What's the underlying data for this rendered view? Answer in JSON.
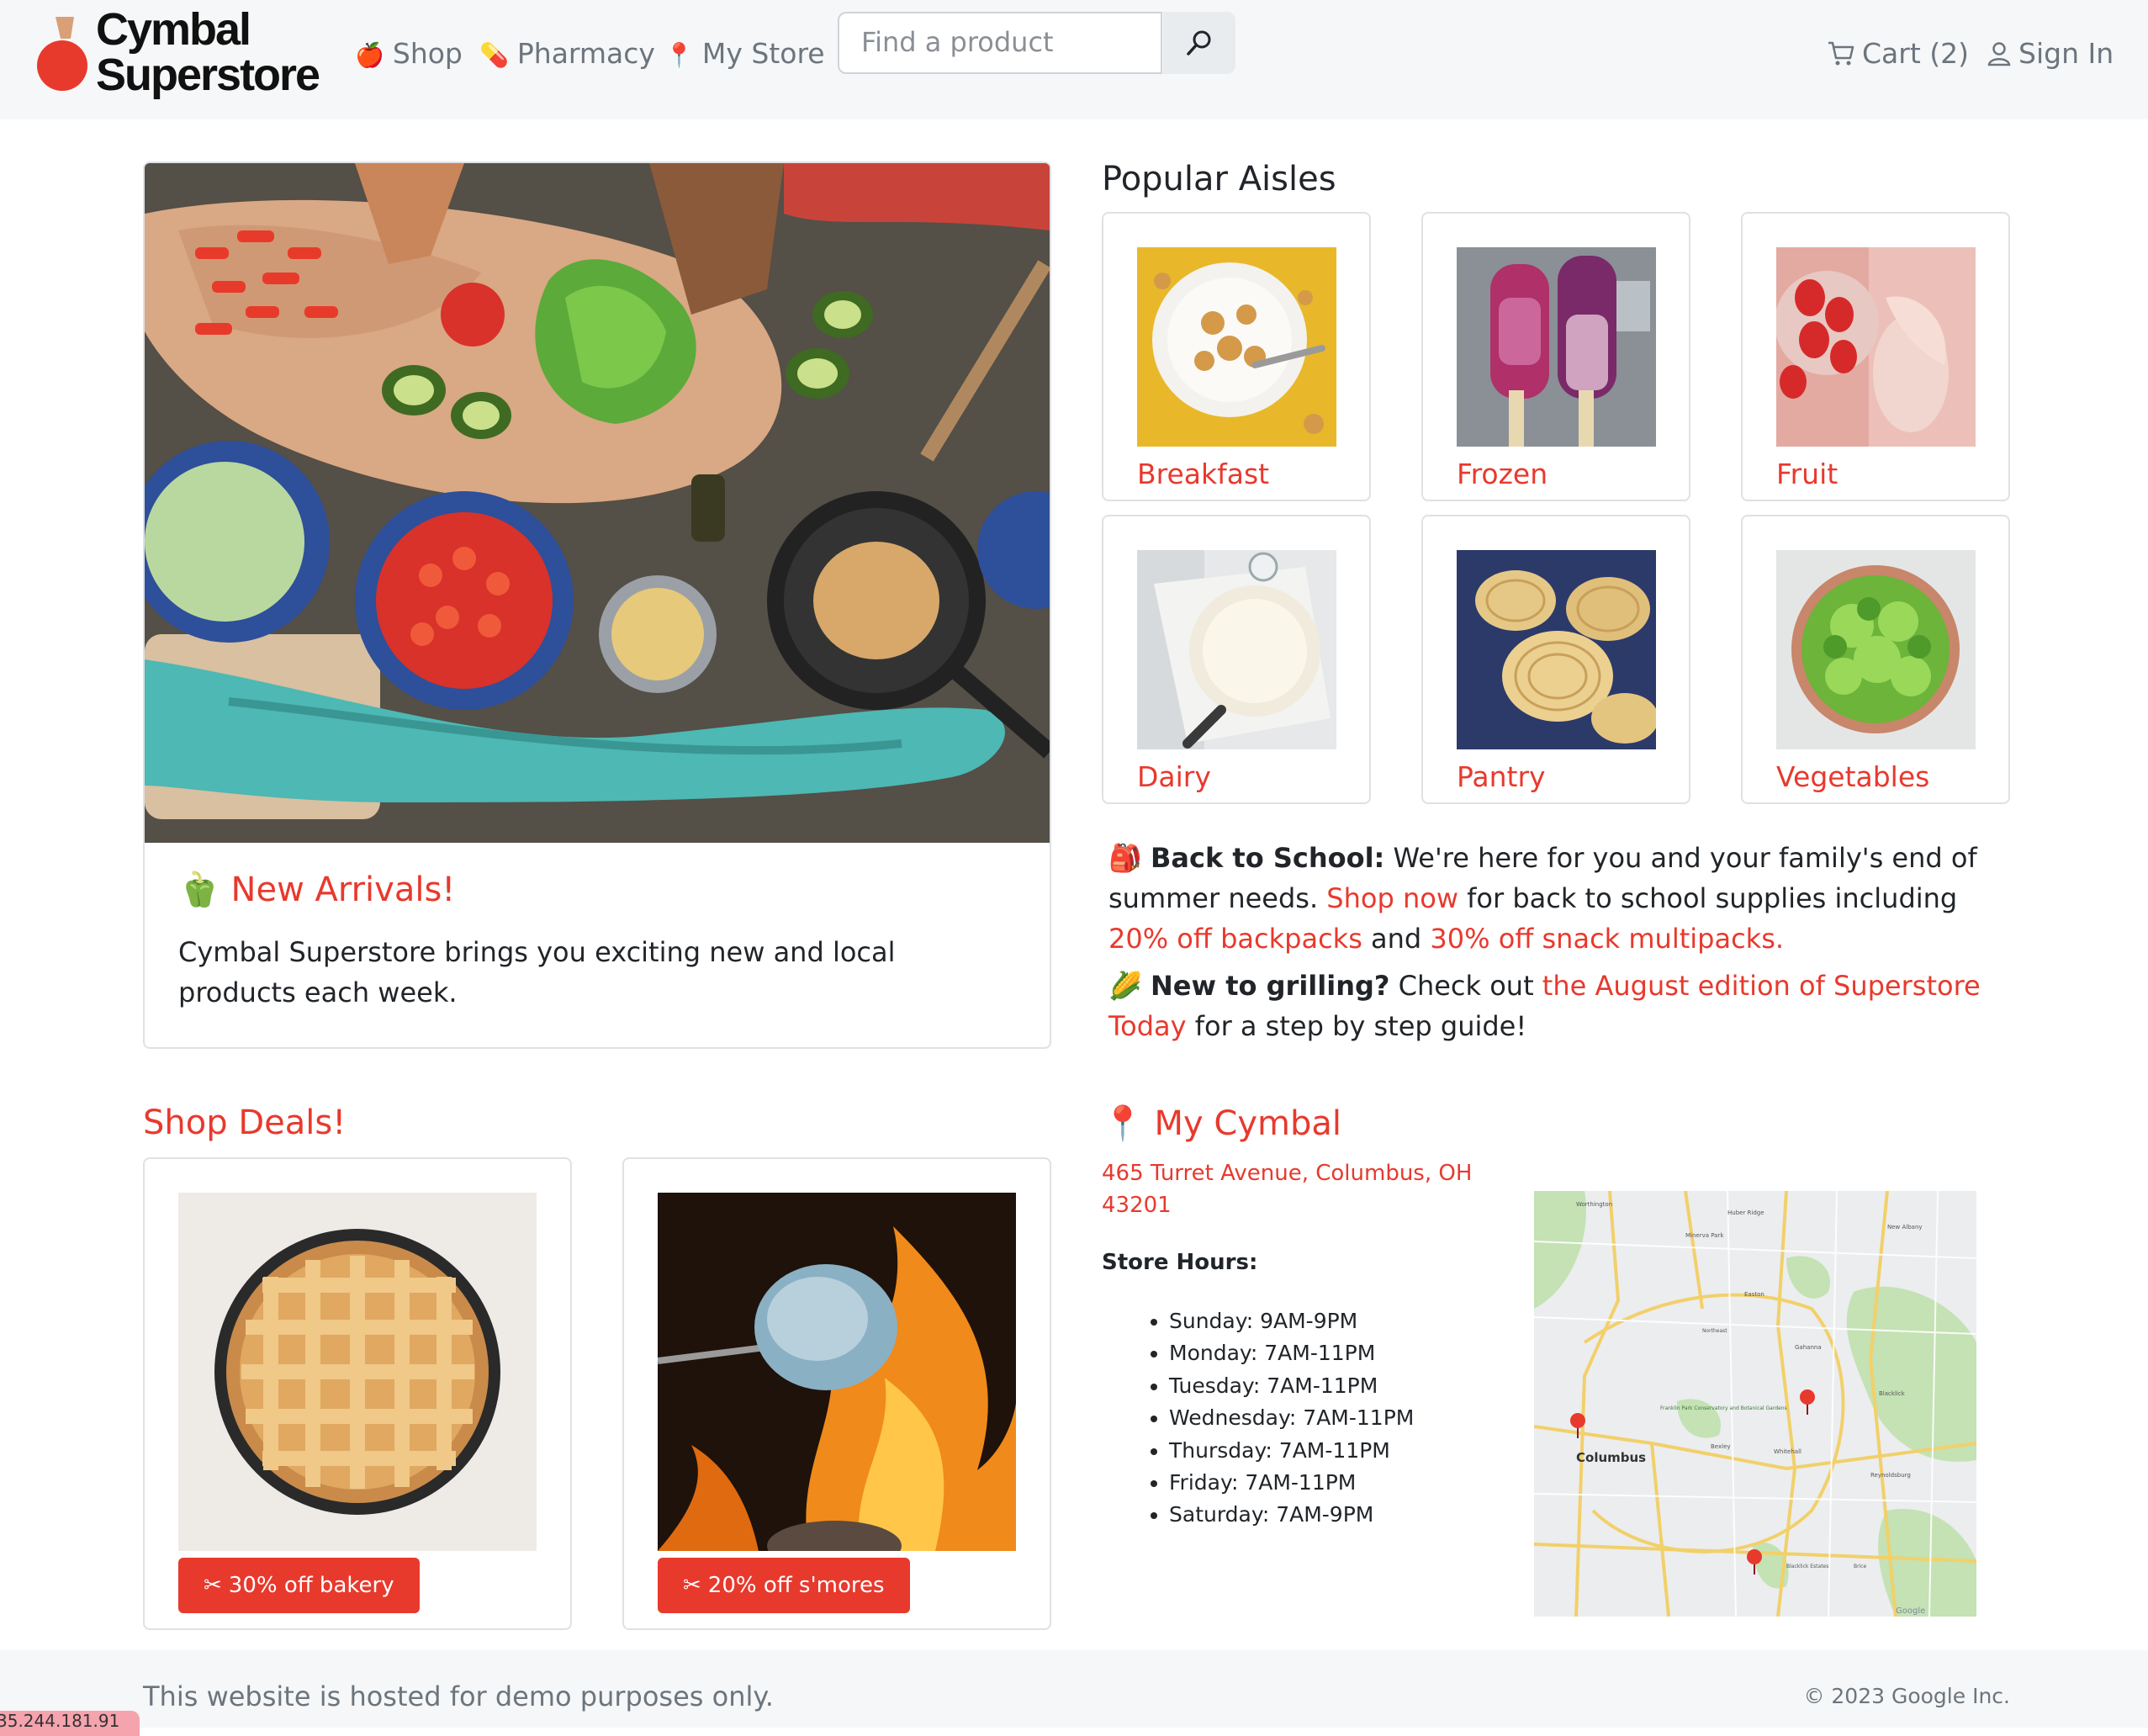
{
  "brand": {
    "line1": "Cymbal",
    "line2": "Superstore",
    "colors": {
      "accent": "#e8392d",
      "logo_leaf": "#d9a078"
    }
  },
  "nav": {
    "shop": {
      "label": "Shop",
      "icon": "apple-emoji"
    },
    "pharmacy": {
      "label": "Pharmacy",
      "icon": "pill-emoji"
    },
    "store": {
      "label": "My Store",
      "icon": "pin-emoji"
    },
    "search": {
      "placeholder": "Find a product",
      "icon": "search-icon"
    },
    "cart": {
      "label": "Cart (2)",
      "icon": "cart-icon"
    },
    "signin": {
      "label": "Sign In",
      "icon": "person-icon"
    }
  },
  "hero": {
    "title": "New Arrivals!",
    "title_icon": "bell-pepper-emoji",
    "text": "Cymbal Superstore brings you exciting new and local products each week.",
    "image": "cooking-table-photo"
  },
  "aisles": {
    "heading": "Popular Aisles",
    "items": [
      {
        "label": "Breakfast",
        "image": "cereal-photo"
      },
      {
        "label": "Frozen",
        "image": "popsicle-photo"
      },
      {
        "label": "Fruit",
        "image": "strawberries-photo"
      },
      {
        "label": "Dairy",
        "image": "cheese-photo"
      },
      {
        "label": "Pantry",
        "image": "pasta-photo"
      },
      {
        "label": "Vegetables",
        "image": "salad-photo"
      }
    ]
  },
  "promos": {
    "school": {
      "icon": "backpack-emoji",
      "title": "Back to School:",
      "text1": " We're here for you and your family's end of summer needs. ",
      "link1": "Shop now",
      "text2": " for back to school supplies including ",
      "link2": "20% off backpacks",
      "text3": " and ",
      "link3": "30% off snack multipacks."
    },
    "grill": {
      "icon": "corn-emoji",
      "title": "New to grilling?",
      "text1": " Check out ",
      "link": "the August edition of Superstore Today",
      "text2": " for a step by step guide!"
    }
  },
  "deals": {
    "heading": "Shop Deals!",
    "items": [
      {
        "label": "30% off bakery",
        "image": "pie-photo",
        "icon": "scissors-icon"
      },
      {
        "label": "20% off s'mores",
        "image": "marshmallow-photo",
        "icon": "scissors-icon"
      }
    ]
  },
  "store": {
    "heading": "My Cymbal",
    "icon": "pin-emoji",
    "address": "465 Turret Avenue, Columbus, OH 43201",
    "hours_title": "Store Hours:",
    "hours": [
      "Sunday: 9AM-9PM",
      "Monday: 7AM-11PM",
      "Tuesday: 7AM-11PM",
      "Wednesday: 7AM-11PM",
      "Thursday: 7AM-11PM",
      "Friday: 7AM-11PM",
      "Saturday: 7AM-9PM"
    ],
    "map": {
      "city": "Columbus",
      "places": [
        "Worthington",
        "Huber Ridge",
        "Minerva Park",
        "New Albany",
        "Easton",
        "Gahanna",
        "Northeast",
        "Franklin Park Conservatory and Botanical Gardens",
        "Bexley",
        "Whitehall",
        "Blacklick",
        "Reynoldsburg",
        "Blacklick Estates",
        "Brice"
      ],
      "attribution": "Google"
    }
  },
  "footer": {
    "disclaimer": "This website is hosted for demo purposes only.",
    "copyright": "© 2023 Google Inc.",
    "ip": "35.244.181.91"
  }
}
